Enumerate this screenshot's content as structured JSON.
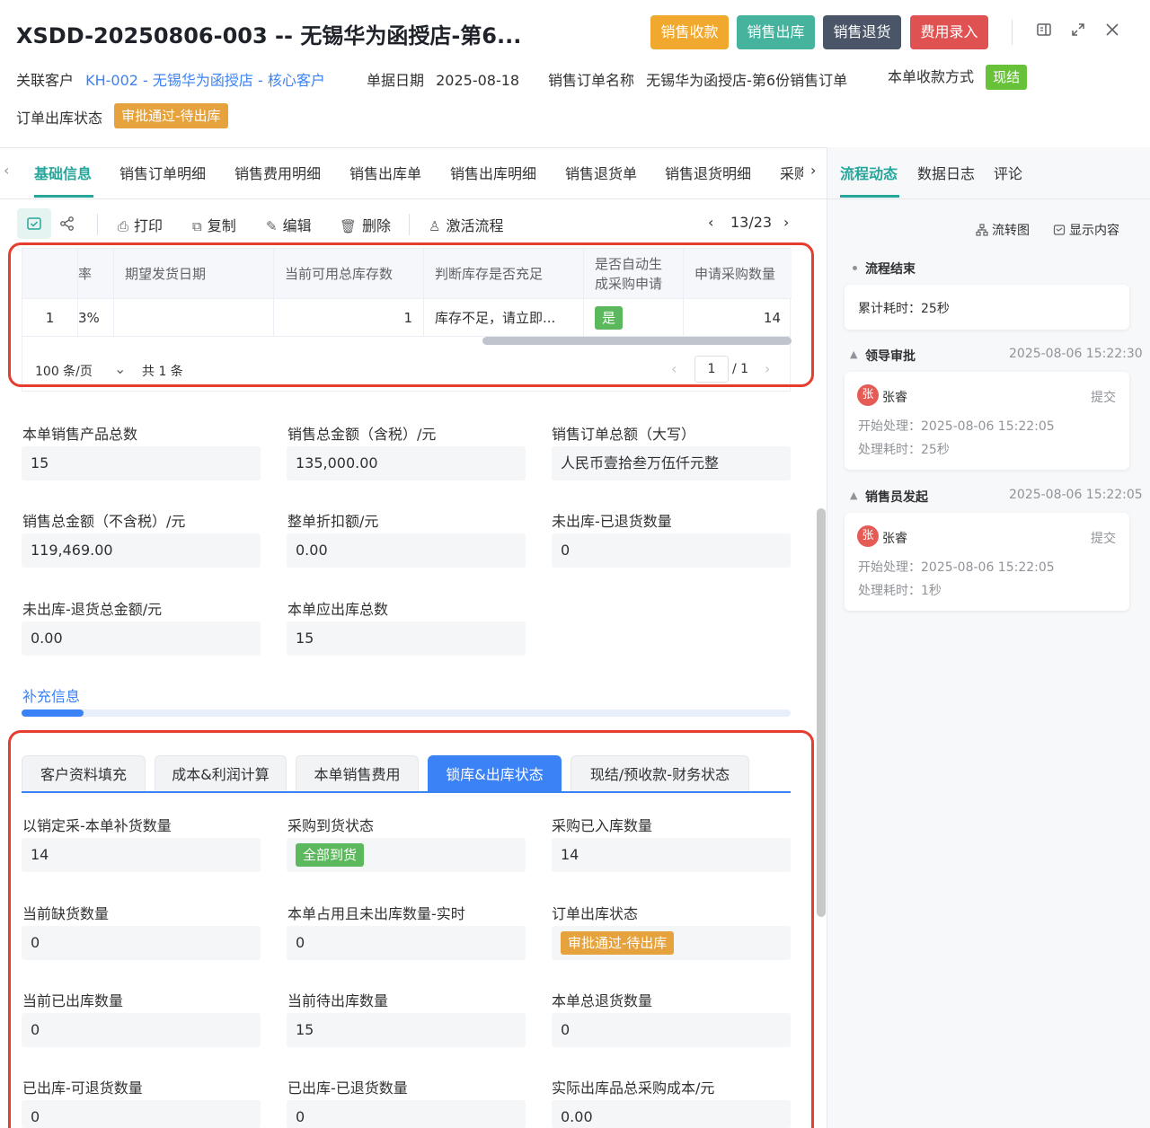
{
  "header": {
    "title": "XSDD-20250806-003 -- 无锡华为函授店-第6...",
    "buttons": [
      {
        "label": "销售收款",
        "color": "#f0a92e"
      },
      {
        "label": "销售出库",
        "color": "#45b39d"
      },
      {
        "label": "销售退货",
        "color": "#4a5568"
      },
      {
        "label": "费用录入",
        "color": "#e05252"
      }
    ]
  },
  "meta": {
    "customer_label": "关联客户",
    "customer_value": "KH-002 -  无锡华为函授店 - 核心客户",
    "date_label": "单据日期",
    "date_value": "2025-08-18",
    "order_name_label": "销售订单名称",
    "order_name_value": "无锡华为函授店-第6份销售订单",
    "payment_label": "本单收款方式",
    "payment_value": "现结",
    "status_label": "订单出库状态",
    "status_value": "审批通过-待出库"
  },
  "tabs": [
    "基础信息",
    "销售订单明细",
    "销售费用明细",
    "销售出库单",
    "销售出库明细",
    "销售退货单",
    "销售退货明细",
    "采购"
  ],
  "right_tabs": [
    "流程动态",
    "数据日志",
    "评论"
  ],
  "toolbar": {
    "print": "打印",
    "copy": "复制",
    "edit": "编辑",
    "delete": "删除",
    "activate": "激活流程",
    "page_indicator": "13/23"
  },
  "table": {
    "headers": [
      "率",
      "期望发货日期",
      "当前可用总库存数",
      "判断库存是否充足",
      "是否自动生成采购申请",
      "申请采购数量"
    ],
    "header_auto_line1": "是否自动生",
    "header_auto_line2": "成采购申请",
    "row": {
      "index": "1",
      "rate": "3%",
      "expected_date": "",
      "available_stock": "1",
      "stock_check": "库存不足，请立即...",
      "auto_purchase": "是",
      "purchase_qty": "14"
    },
    "page_size": "100 条/页",
    "total": "共 1 条",
    "current_page": "1",
    "total_pages": "/ 1"
  },
  "summary": [
    {
      "label": "本单销售产品总数",
      "value": "15"
    },
    {
      "label": "销售总金额（含税）/元",
      "value": "135,000.00"
    },
    {
      "label": "销售订单总额（大写）",
      "value": "人民币壹拾叁万伍仟元整"
    },
    {
      "label": "销售总金额（不含税）/元",
      "value": "119,469.00"
    },
    {
      "label": "整单折扣额/元",
      "value": "0.00"
    },
    {
      "label": "未出库-已退货数量",
      "value": "0"
    },
    {
      "label": "未出库-退货总金额/元",
      "value": "0.00"
    },
    {
      "label": "本单应出库总数",
      "value": "15"
    }
  ],
  "supplement": {
    "title": "补充信息",
    "tabs": [
      "客户资料填充",
      "成本&利润计算",
      "本单销售费用",
      "锁库&出库状态",
      "现结/预收款-财务状态"
    ],
    "active_tab": "锁库&出库状态"
  },
  "lock_fields": [
    {
      "label": "以销定采-本单补货数量",
      "value": "14"
    },
    {
      "label": "采购到货状态",
      "value": "全部到货"
    },
    {
      "label": "采购已入库数量",
      "value": "14"
    },
    {
      "label": "当前缺货数量",
      "value": "0"
    },
    {
      "label": "本单占用且未出库数量-实时",
      "value": "0"
    },
    {
      "label": "订单出库状态",
      "value": "审批通过-待出库"
    },
    {
      "label": "当前已出库数量",
      "value": "0"
    },
    {
      "label": "当前待出库数量",
      "value": "15"
    },
    {
      "label": "本单总退货数量",
      "value": "0"
    },
    {
      "label": "已出库-可退货数量",
      "value": "0"
    },
    {
      "label": "已出库-已退货数量",
      "value": "0"
    },
    {
      "label": "实际出库品总采购成本/元",
      "value": "0.00"
    }
  ],
  "process": {
    "flowchart": "流转图",
    "show_content": "显示内容",
    "end_label": "流程结束",
    "total_time": "累计耗时：25秒",
    "steps": [
      {
        "title": "领导审批",
        "time": "2025-08-06 15:22:30",
        "user": "张睿",
        "avatar": "张",
        "action": "提交",
        "start": "开始处理：2025-08-06 15:22:05",
        "duration": "处理耗时：25秒"
      },
      {
        "title": "销售员发起",
        "time": "2025-08-06 15:22:05",
        "user": "张睿",
        "avatar": "张",
        "action": "提交",
        "start": "开始处理：2025-08-06 15:22:05",
        "duration": "处理耗时：1秒"
      }
    ]
  }
}
